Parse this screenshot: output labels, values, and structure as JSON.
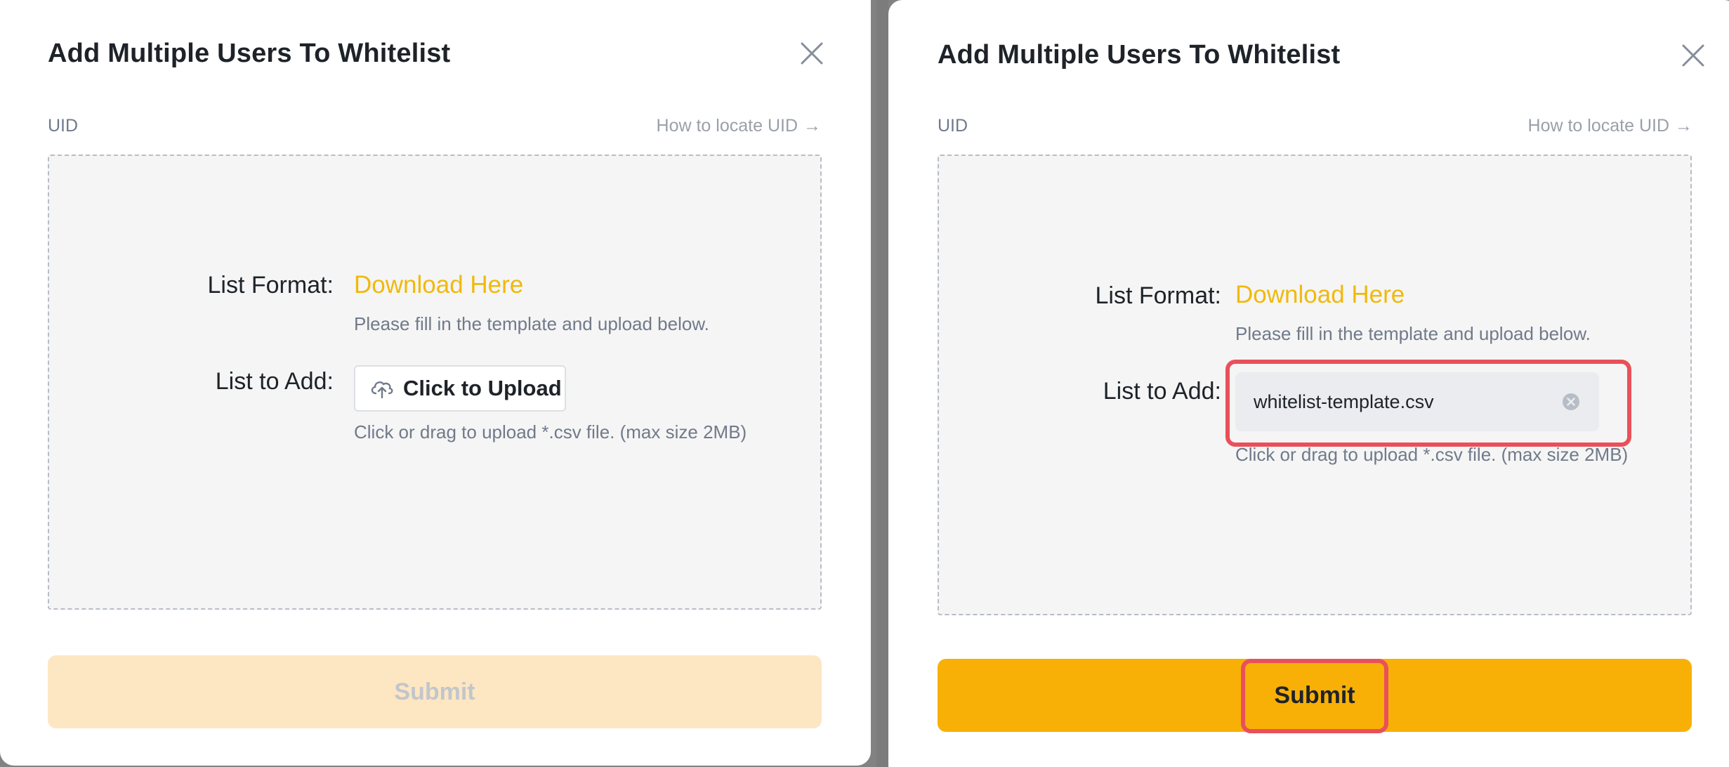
{
  "colors": {
    "accent": "#f0b90b",
    "submit_enabled": "#f8b007",
    "submit_disabled": "#fde6c2",
    "highlight": "#e9505a",
    "dropzone_bg": "#f5f5f5"
  },
  "left_panel": {
    "title": "Add Multiple Users To Whitelist",
    "close_icon": "close-icon",
    "uid_label": "UID",
    "locate_link": "How to locate UID",
    "locate_arrow": "→",
    "list_format_label": "List Format:",
    "download_link": "Download Here",
    "template_hint": "Please fill in the template and upload below.",
    "list_to_add_label": "List to Add:",
    "upload_button": "Click to Upload",
    "upload_icon": "cloud-upload-icon",
    "upload_hint": "Click or drag to upload *.csv file. (max size 2MB)",
    "submit": "Submit",
    "submit_state": "disabled"
  },
  "right_panel": {
    "title": "Add Multiple Users To Whitelist",
    "close_icon": "close-icon",
    "uid_label": "UID",
    "locate_link": "How to locate UID",
    "locate_arrow": "→",
    "list_format_label": "List Format:",
    "download_link": "Download Here",
    "template_hint": "Please fill in the template and upload below.",
    "list_to_add_label": "List to Add:",
    "uploaded_file": "whitelist-template.csv",
    "remove_icon": "remove-file-icon",
    "upload_hint": "Click or drag to upload *.csv file. (max size 2MB)",
    "submit": "Submit",
    "submit_state": "enabled"
  }
}
